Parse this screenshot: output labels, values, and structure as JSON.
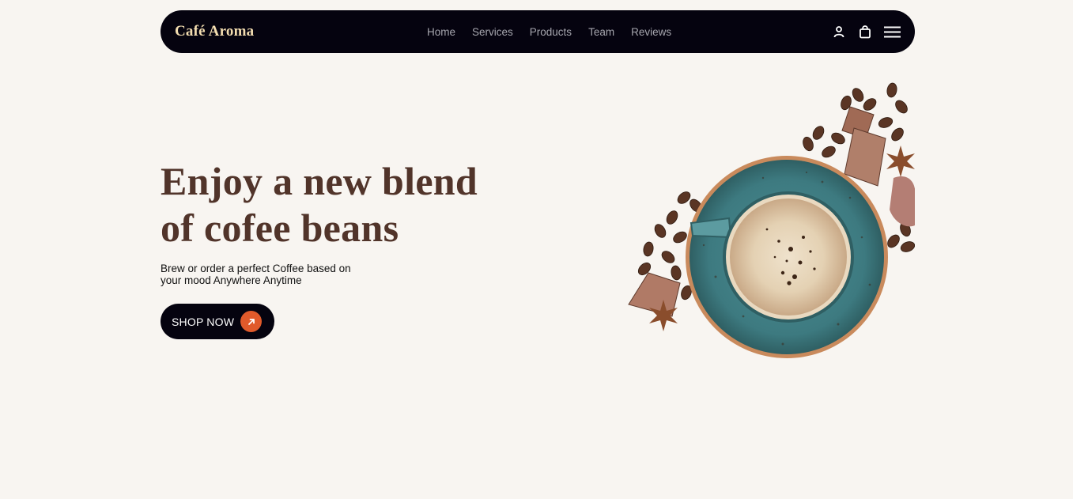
{
  "brand": {
    "name": "Café Aroma"
  },
  "nav": {
    "links": [
      "Home",
      "Services",
      "Products",
      "Team",
      "Reviews"
    ]
  },
  "icons": {
    "account": "user-icon",
    "cart": "shopping-bag-icon",
    "menu": "hamburger-menu-icon",
    "cta_arrow": "arrow-up-right-icon"
  },
  "hero": {
    "title_line1": "Enjoy a new blend",
    "title_line2": "of cofee beans",
    "subtitle_line1": "Brew or order a perfect Coffee based on",
    "subtitle_line2": "your mood Anywhere Anytime",
    "cta_label": "SHOP NOW",
    "image_subject": "coffee cup with coffee beans, chocolate and star anise"
  },
  "colors": {
    "background": "#f8f5f1",
    "navbar": "#05030f",
    "brand_text": "#f3ddb0",
    "nav_link": "#a6a6ae",
    "title": "#51342a",
    "cta_accent": "#e05a2b",
    "cup": "#3f7f86"
  }
}
